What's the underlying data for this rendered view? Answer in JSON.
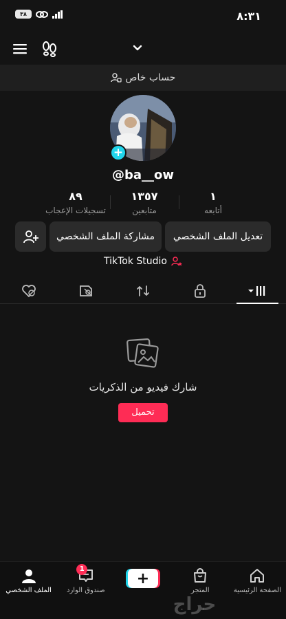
{
  "status": {
    "time": "٨:٣١",
    "battery": "٣٨"
  },
  "header": {
    "private_label": "حساب خاص"
  },
  "profile": {
    "username": "@ba__ow",
    "stats": [
      {
        "value": "١",
        "label": "أتابعه"
      },
      {
        "value": "١٣٥٧",
        "label": "متابعين"
      },
      {
        "value": "٨٩",
        "label": "تسجيلات الإعجاب"
      }
    ],
    "edit_button": "تعديل الملف الشخصي",
    "share_button": "مشاركة الملف الشخصي",
    "studio_label": "TikTok Studio"
  },
  "tabs": [
    {
      "icon": "grid-icon",
      "active": true
    },
    {
      "icon": "lock-icon",
      "active": false
    },
    {
      "icon": "repost-icon",
      "active": false
    },
    {
      "icon": "tag-icon",
      "active": false
    },
    {
      "icon": "liked-hidden-icon",
      "active": false
    }
  ],
  "empty_state": {
    "text": "شارك فيديو من الذكريات",
    "upload_label": "تحميل"
  },
  "bottom_nav": {
    "home": "الصفحة الرئيسية",
    "shop": "المتجر",
    "inbox": "صندوق الوارد",
    "inbox_badge": "1",
    "profile": "الملف الشخصي"
  },
  "watermark": "حراج",
  "colors": {
    "accent_red": "#fe2c55",
    "accent_cyan": "#20d5ec",
    "background": "#141414"
  }
}
